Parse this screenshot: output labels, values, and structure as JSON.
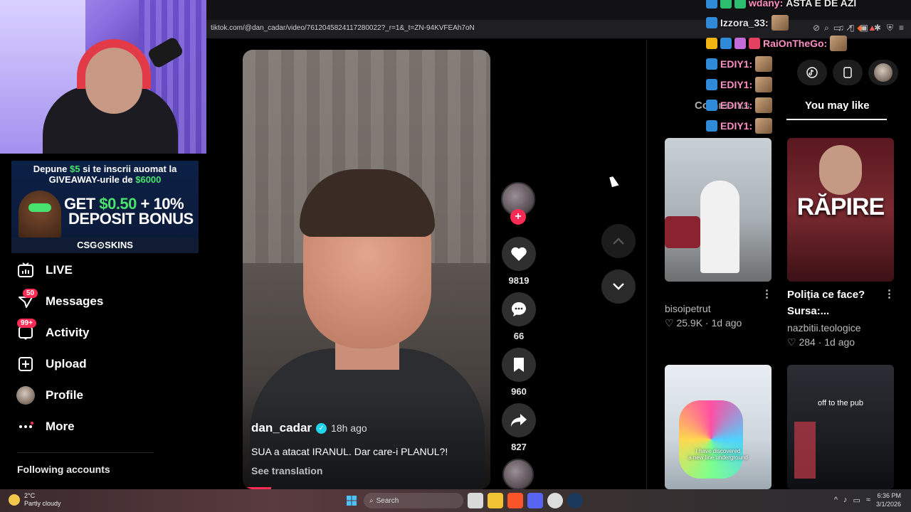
{
  "browser": {
    "url": "tiktok.com/@dan_cadar/video/7612045824117280022?_r=1&_t=ZN-94KVFEAh7oN"
  },
  "promo": {
    "line1_pre": "Depune ",
    "line1_amount": "$5",
    "line1_post": " si te inscrii auomat la",
    "line2_pre": "GIVEAWAY-urile de ",
    "line2_amount": "$6000",
    "bonus_line1_pre": "GET ",
    "bonus_line1_green": "$0.50",
    "bonus_line1_post": " + 10%",
    "bonus_line2": "DEPOSIT BONUS",
    "footer": "CSG⊙SKINS"
  },
  "nav": {
    "live": "LIVE",
    "messages": "Messages",
    "messages_badge": "50",
    "activity": "Activity",
    "activity_badge": "99+",
    "upload": "Upload",
    "profile": "Profile",
    "more": "More",
    "following": "Following accounts"
  },
  "video": {
    "author": "dan_cadar",
    "time": "18h ago",
    "caption": "SUA a atacat IRANUL. Dar care-i PLANUL?!",
    "translate": "See translation",
    "likes": "9819",
    "comments": "66",
    "saves": "960",
    "shares": "827"
  },
  "right_panel": {
    "tab_comments": "Comments",
    "tab_you_may_like": "You may like",
    "items": [
      {
        "author": "bisoipetrut",
        "likes": "25.9K",
        "age": "1d ago"
      },
      {
        "title_line1": "Poliția ce face?",
        "title_line2": "Sursa:...",
        "thumb_text": "RĂPIRE",
        "author": "nazbitii.teologice",
        "likes": "284",
        "age": "1d ago"
      },
      {
        "thumb_caption_1": "I have discovered",
        "thumb_caption_2": "a new line underground"
      },
      {
        "thumb_caption": "off to the pub"
      }
    ]
  },
  "chat": [
    {
      "name": "wdany:",
      "message": "ASTA E DE AZI"
    },
    {
      "name": "Izzora_33:"
    },
    {
      "name": "RaiOnTheGo:"
    },
    {
      "name": "EDIY1:"
    },
    {
      "name": "EDIY1:"
    },
    {
      "name": "EDIY1:"
    },
    {
      "name": "EDIY1:"
    }
  ],
  "taskbar": {
    "temp": "2°C",
    "weather": "Partly cloudy",
    "search": "Search",
    "time": "6:36 PM",
    "date": "3/1/2026"
  },
  "colors": {
    "tiktok_red": "#fe2c55",
    "verified": "#20d5ec",
    "promo_green": "#48e36e"
  }
}
